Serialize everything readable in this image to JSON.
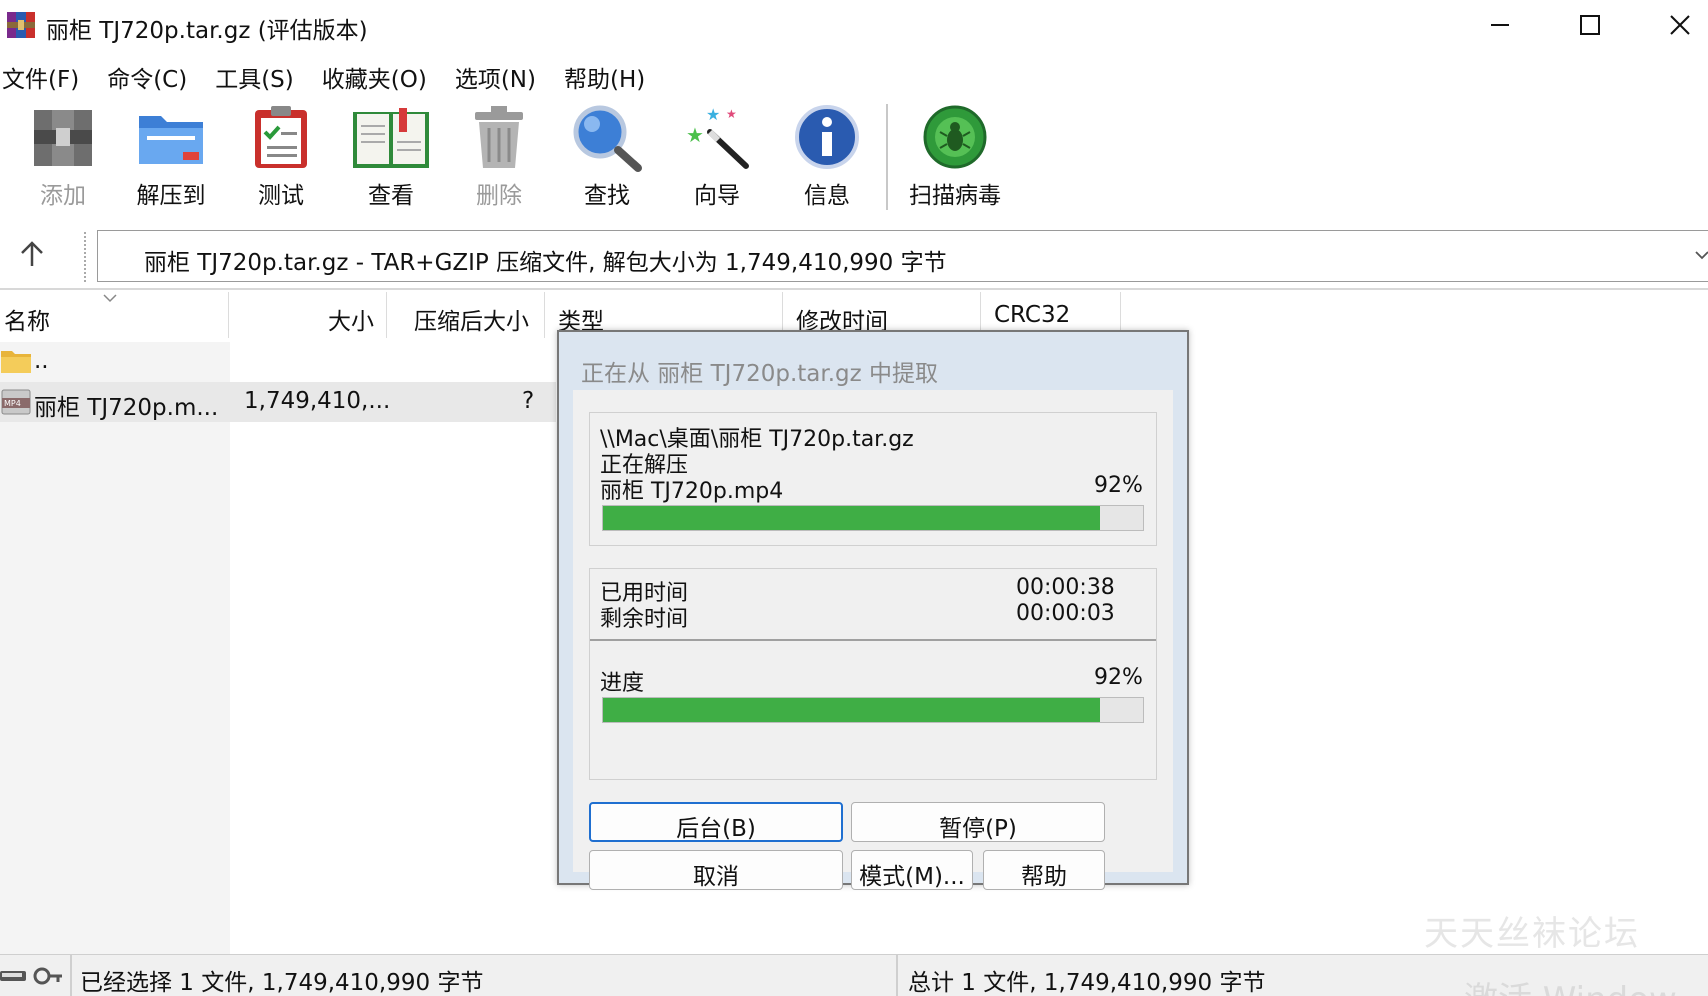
{
  "window": {
    "title": "丽柜 TJ720p.tar.gz (评估版本)"
  },
  "menu": [
    "文件(F)",
    "命令(C)",
    "工具(S)",
    "收藏夹(O)",
    "选项(N)",
    "帮助(H)"
  ],
  "toolbar": {
    "add": "添加",
    "extract": "解压到",
    "test": "测试",
    "view": "查看",
    "delete": "删除",
    "find": "查找",
    "wizard": "向导",
    "info": "信息",
    "scan": "扫描病毒"
  },
  "address": {
    "text": "丽柜 TJ720p.tar.gz - TAR+GZIP 压缩文件, 解包大小为 1,749,410,990 字节"
  },
  "columns": {
    "name": "名称",
    "size": "大小",
    "packed": "压缩后大小",
    "type": "类型",
    "modified": "修改时间",
    "crc": "CRC32"
  },
  "rows": [
    {
      "name": "..",
      "size": "",
      "packed": ""
    },
    {
      "name": "丽柜 TJ720p.m...",
      "size": "1,749,410,...",
      "packed": "?"
    }
  ],
  "status": {
    "left": "已经选择 1 文件, 1,749,410,990 字节",
    "right": "总计 1 文件, 1,749,410,990 字节"
  },
  "watermark": {
    "forum": "天天丝袜论坛",
    "activate": "激活 Window"
  },
  "dialog": {
    "title": "正在从 丽柜 TJ720p.tar.gz 中提取",
    "path": "\\\\Mac\\桌面\\丽柜 TJ720p.tar.gz",
    "action": "正在解压",
    "file": "丽柜 TJ720p.mp4",
    "file_percent_label": "92%",
    "file_progress": 0.92,
    "elapsed_label": "已用时间",
    "elapsed_value": "00:00:38",
    "remaining_label": "剩余时间",
    "remaining_value": "00:00:03",
    "progress_label": "进度",
    "total_percent_label": "92%",
    "total_progress": 0.92,
    "buttons": {
      "background": "后台(B)",
      "pause": "暂停(P)",
      "cancel": "取消",
      "mode": "模式(M)...",
      "help": "帮助"
    }
  },
  "colors": {
    "progress_fill": "#3fae45",
    "dialog_frame": "#dbe5f0",
    "focus_border": "#1f6fd0"
  }
}
